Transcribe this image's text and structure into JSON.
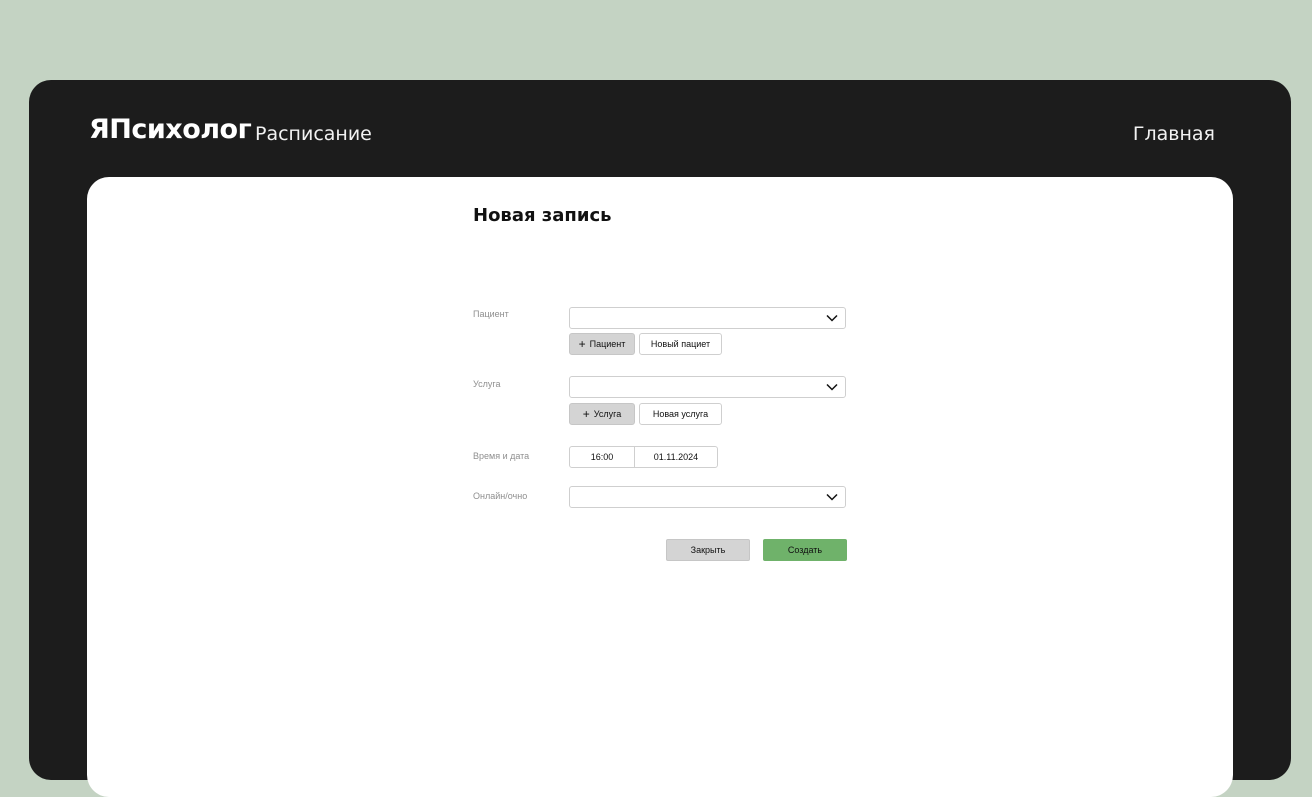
{
  "header": {
    "logo": "ЯПсихолог",
    "section": "Расписание",
    "nav_home": "Главная"
  },
  "form": {
    "title": "Новая запись",
    "patient": {
      "label": "Пациент",
      "value": "",
      "add_label": "Пациент",
      "new_label": "Новый пациет"
    },
    "service": {
      "label": "Услуга",
      "value": "",
      "add_label": "Услуга",
      "new_label": "Новая услуга"
    },
    "datetime": {
      "label": "Время и дата",
      "time": "16:00",
      "date": "01.11.2024"
    },
    "format": {
      "label": "Онлайн/очно",
      "value": ""
    },
    "buttons": {
      "close": "Закрыть",
      "create": "Создать"
    }
  },
  "icons": {
    "dropdown": "chevron-down-icon",
    "add": "plus-icon"
  },
  "colors": {
    "page_bg": "#c4d3c3",
    "frame_bg": "#1c1c1c",
    "panel_bg": "#ffffff",
    "accent": "#6fb26a",
    "secondary_button": "#d4d4d4"
  }
}
